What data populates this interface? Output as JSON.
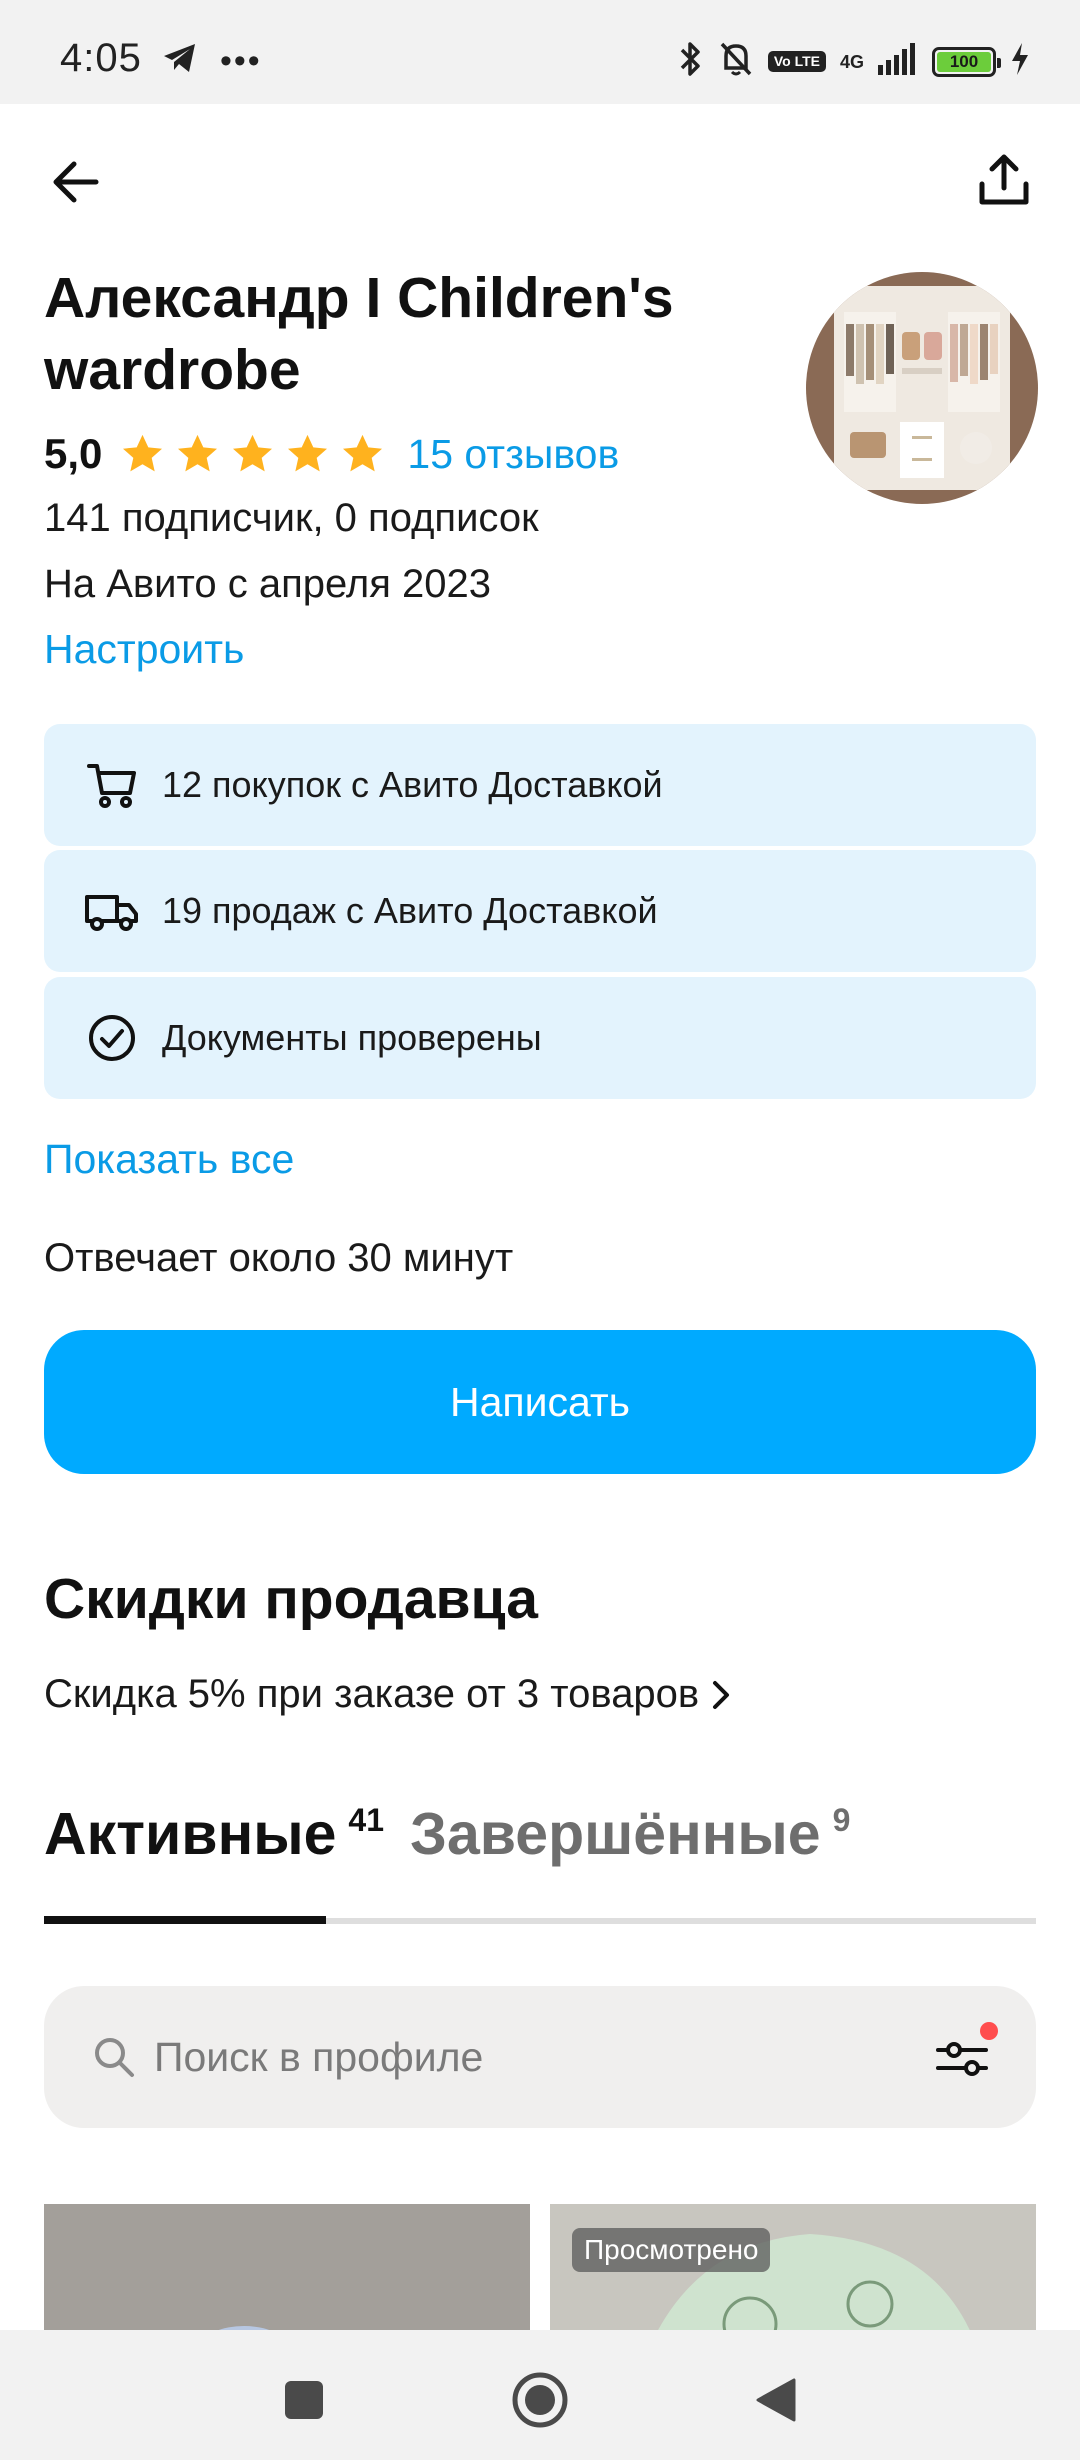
{
  "status_bar": {
    "time": "4:05",
    "left_icons": [
      "telegram-icon",
      "more-dots-icon"
    ],
    "right_icons": [
      "bluetooth-icon",
      "bell-off-icon",
      "volte-icon",
      "signal-icon",
      "battery-icon",
      "charging-icon"
    ],
    "volte_label": "Vo LTE",
    "network": "4G",
    "battery": "100"
  },
  "header": {
    "back_icon": "arrow-left-icon",
    "share_icon": "share-icon"
  },
  "seller": {
    "name": "Александр I Children's wardrobe",
    "rating": "5,0",
    "stars": 5,
    "reviews": "15 отзывов",
    "subscribers": "141 подписчик, 0 подписок",
    "since": "На Авито с апреля 2023",
    "customize": "Настроить"
  },
  "info_cards": [
    {
      "icon": "cart-icon",
      "text": "12 покупок с Авито Доставкой"
    },
    {
      "icon": "truck-icon",
      "text": "19 продаж с Авито Доставкой"
    },
    {
      "icon": "check-circle-icon",
      "text": "Документы проверены"
    }
  ],
  "show_all": "Показать все",
  "responds": "Отвечает около 30 минут",
  "write_button": "Написать",
  "discounts": {
    "title": "Скидки продавца",
    "item": "Скидка 5% при заказе от 3 товаров"
  },
  "tabs": [
    {
      "label": "Активные",
      "count": "41",
      "active": true
    },
    {
      "label": "Завершённые",
      "count": "9",
      "active": false
    }
  ],
  "search": {
    "placeholder": "Поиск в профиле"
  },
  "products": [
    {
      "badge": ""
    },
    {
      "badge": "Просмотрено"
    }
  ],
  "colors": {
    "accent": "#00aaff",
    "link": "#0a9be6",
    "card_bg": "#e3f3fd",
    "star": "#ffb21e"
  }
}
